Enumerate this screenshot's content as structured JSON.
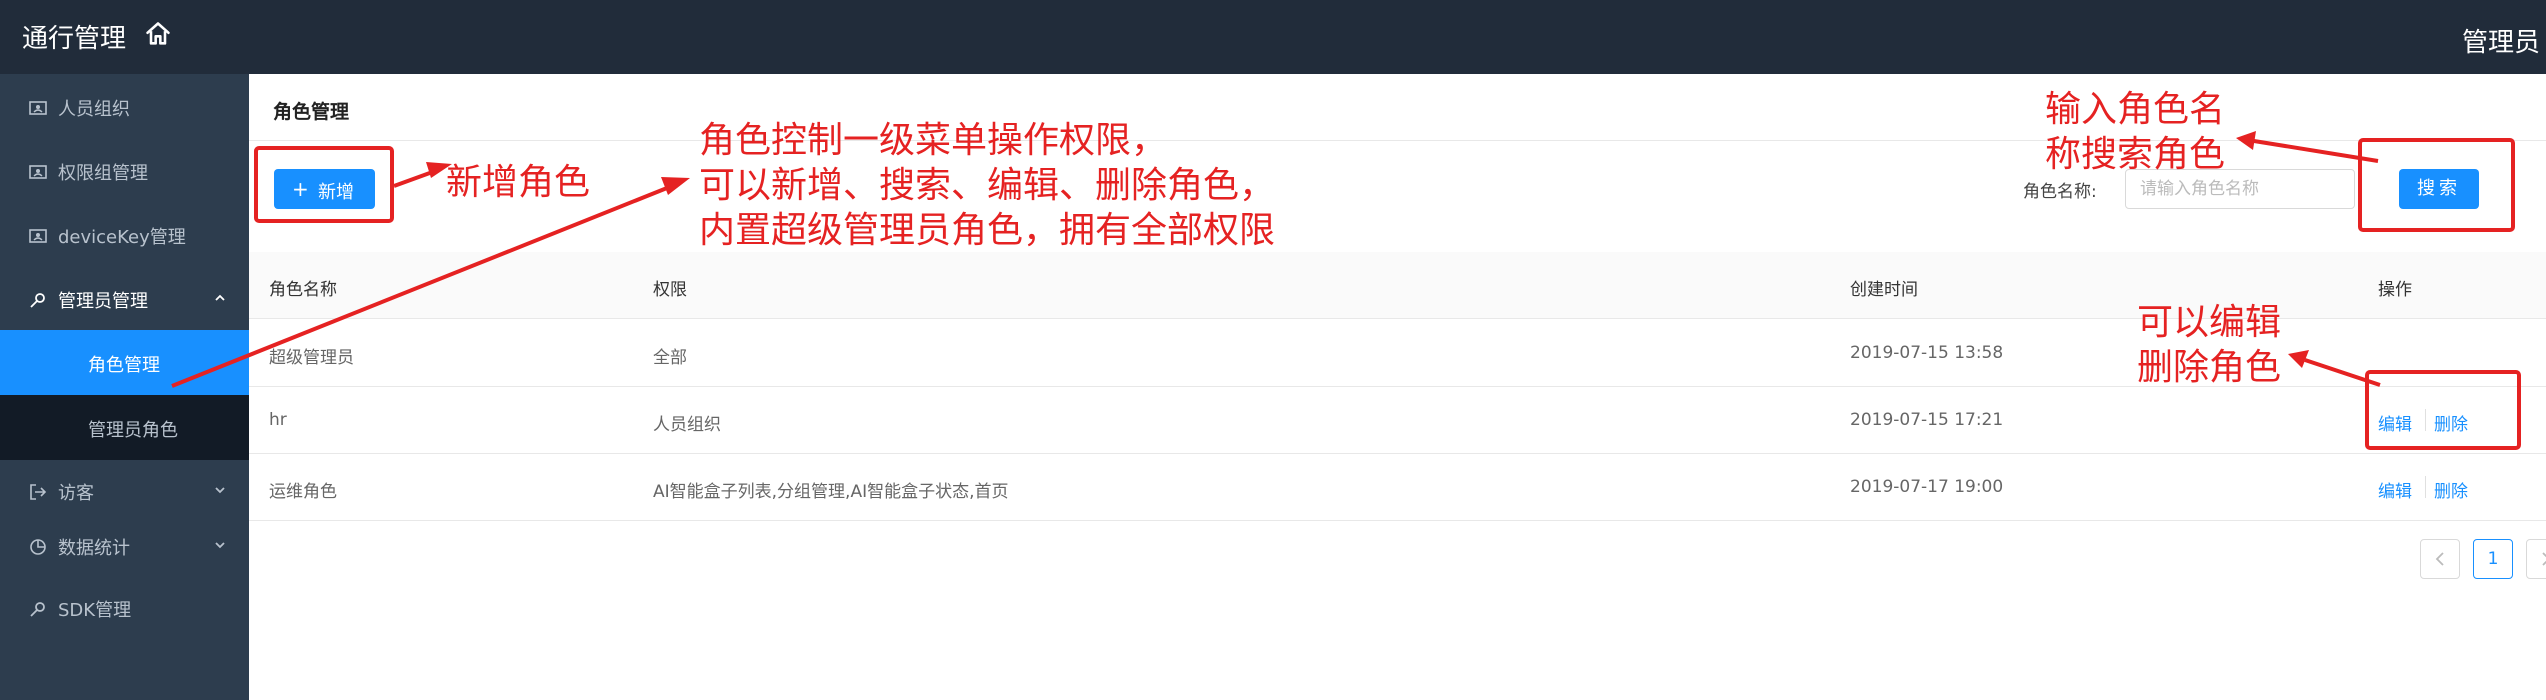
{
  "header": {
    "app_title": "通行管理",
    "user": "管理员"
  },
  "sidebar": {
    "items": [
      {
        "label": "人员组织"
      },
      {
        "label": "权限组管理"
      },
      {
        "label": "deviceKey管理"
      },
      {
        "label": "管理员管理"
      },
      {
        "label": "访客"
      },
      {
        "label": "数据统计"
      },
      {
        "label": "SDK管理"
      }
    ],
    "submenu": [
      {
        "label": "角色管理"
      },
      {
        "label": "管理员角色"
      }
    ]
  },
  "page": {
    "title": "角色管理"
  },
  "toolbar": {
    "add_label": "新增",
    "search_label": "角色名称:",
    "search_placeholder": "请输入角色名称",
    "search_button": "搜索"
  },
  "table": {
    "columns": [
      "角色名称",
      "权限",
      "创建时间",
      "操作"
    ],
    "rows": [
      {
        "name": "超级管理员",
        "permissions": "全部",
        "created": "2019-07-15 13:58"
      },
      {
        "name": "hr",
        "permissions": "人员组织",
        "created": "2019-07-15 17:21",
        "edit": "编辑",
        "delete": "删除"
      },
      {
        "name": "运维角色",
        "permissions": "AI智能盒子列表,分组管理,AI智能盒子状态,首页",
        "created": "2019-07-17 19:00",
        "edit": "编辑",
        "delete": "删除"
      }
    ]
  },
  "pagination": {
    "current": "1"
  },
  "annotations": {
    "add_role": "新增角色",
    "menu_control": "角色控制一级菜单操作权限，\n可以新增、搜索、编辑、删除角色，\n内置超级管理员角色，拥有全部权限",
    "search_hint": "输入角色名\n称搜索角色",
    "edit_hint": "可以编辑\n删除角色",
    "color": "#e52222"
  },
  "colors": {
    "topbar": "#212c3a",
    "sidebar": "#2d3d4e",
    "accent": "#1890ff"
  }
}
